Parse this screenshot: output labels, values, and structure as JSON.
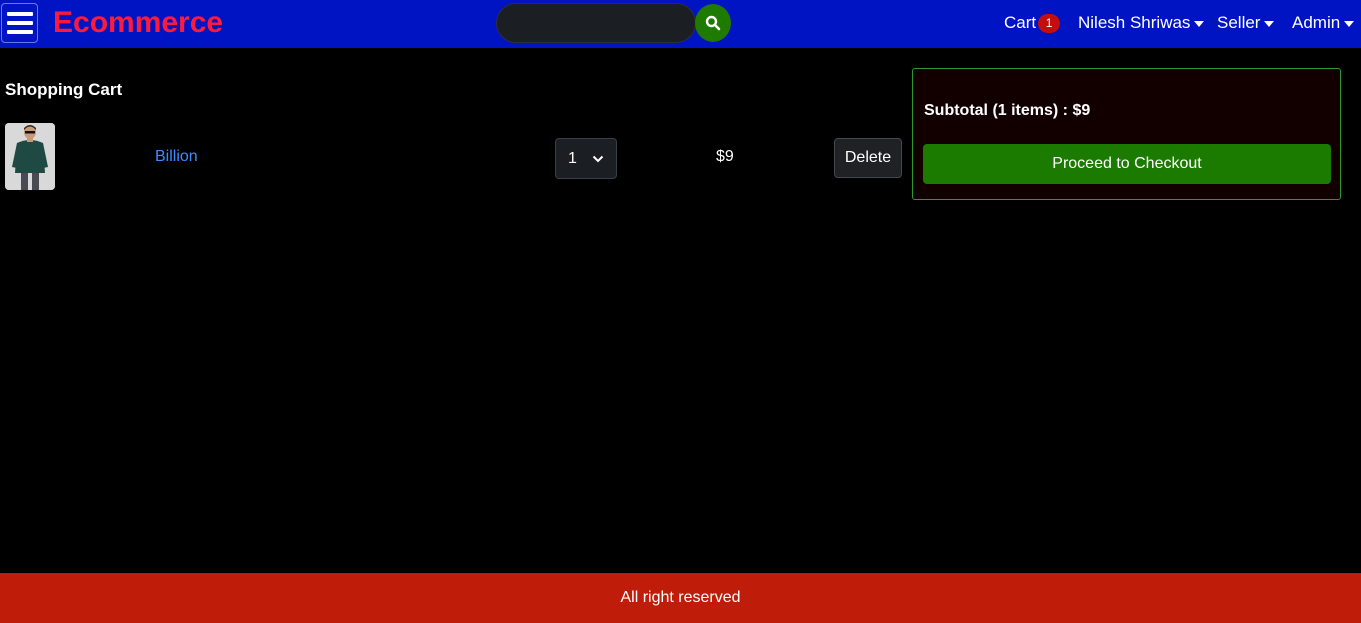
{
  "header": {
    "brand": "Ecommerce",
    "search": {
      "value": "",
      "placeholder": ""
    },
    "cart_label": "Cart",
    "cart_count": "1",
    "user_menu": "Nilesh Shriwas",
    "seller_menu": "Seller",
    "admin_menu": "Admin"
  },
  "cart": {
    "title": "Shopping Cart",
    "items": [
      {
        "name": "Billion",
        "quantity": "1",
        "price": "$9",
        "delete_label": "Delete"
      }
    ]
  },
  "summary": {
    "subtotal": "Subtotal (1 items) : $9",
    "checkout_label": "Proceed to Checkout"
  },
  "footer": {
    "text": "All right reserved"
  },
  "colors": {
    "navbar": "#0014c4",
    "brand": "#ff1a3c",
    "accent_green": "#1b7a00",
    "footer": "#bf1d0a",
    "link": "#3d8bfd"
  },
  "icons": [
    "hamburger-menu-icon",
    "search-icon",
    "chevron-down-icon"
  ]
}
